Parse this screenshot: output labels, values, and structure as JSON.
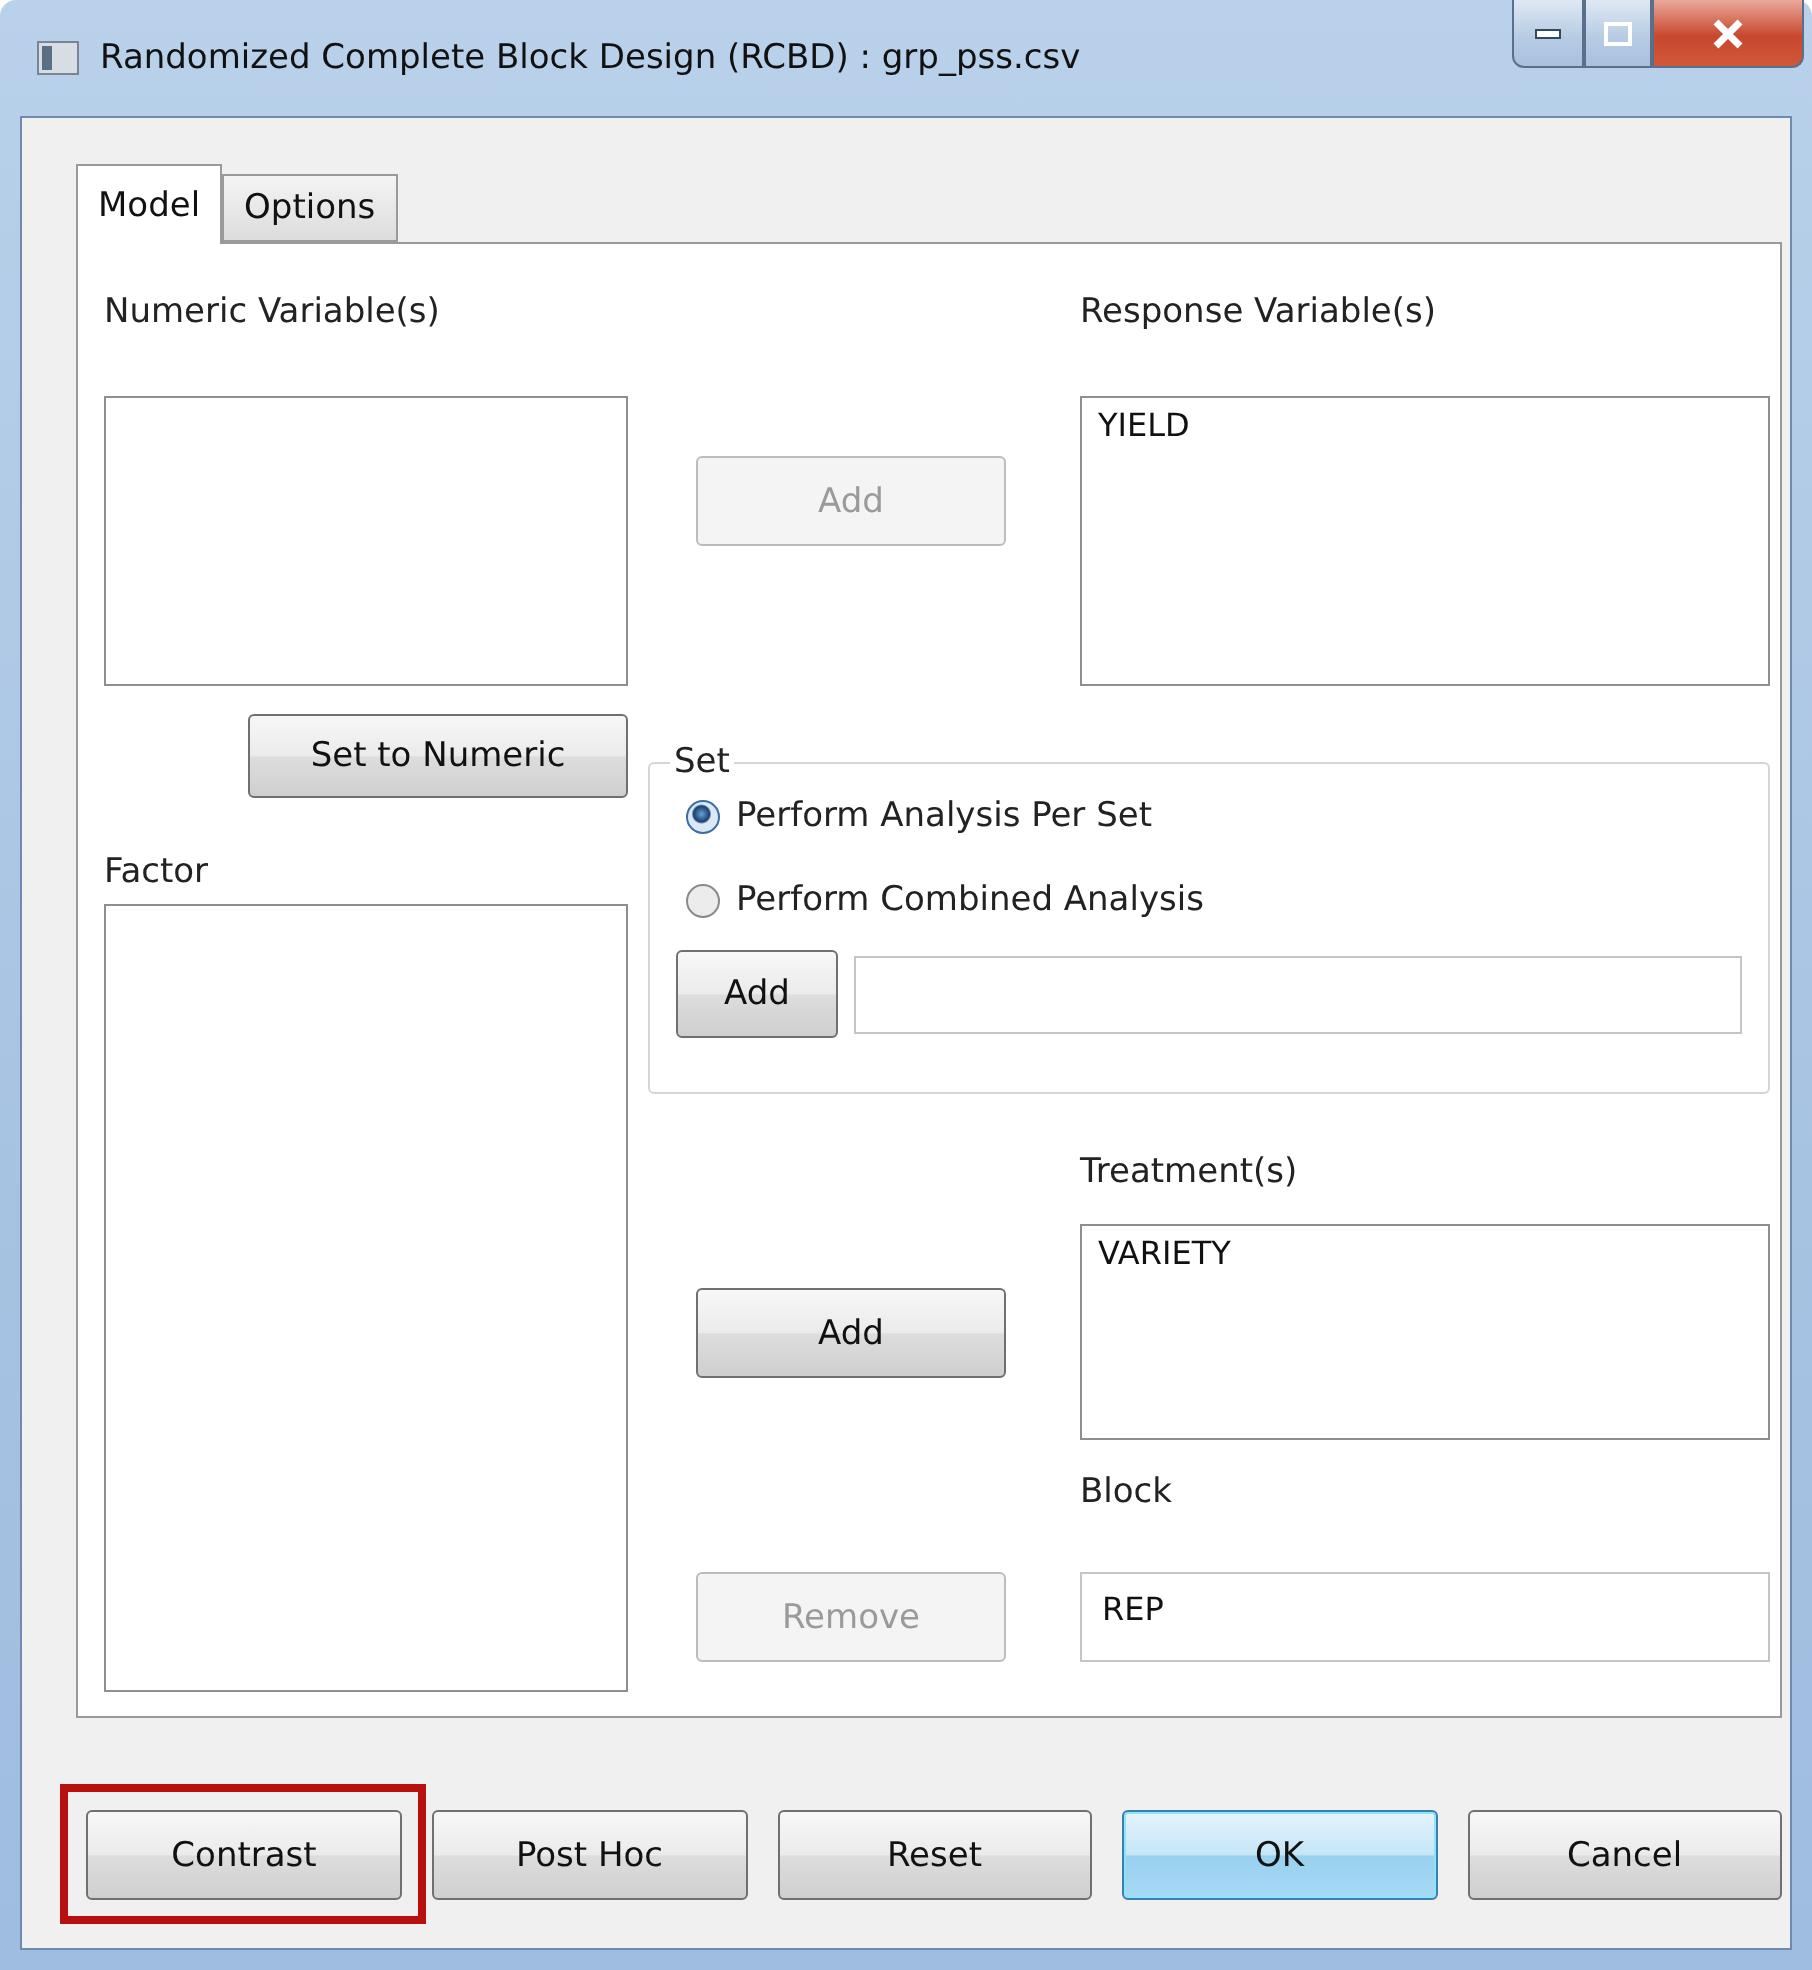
{
  "window": {
    "title": "Randomized Complete Block Design (RCBD) : grp_pss.csv"
  },
  "tabs": [
    {
      "label": "Model",
      "selected": true
    },
    {
      "label": "Options",
      "selected": false
    }
  ],
  "numeric": {
    "label": "Numeric Variable(s)"
  },
  "response": {
    "label": "Response Variable(s)",
    "items": [
      "YIELD"
    ]
  },
  "add_response": {
    "label": "Add",
    "disabled": true
  },
  "set_to_numeric": {
    "label": "Set to Numeric",
    "disabled": false
  },
  "factor": {
    "label": "Factor"
  },
  "set": {
    "legend": "Set",
    "options": [
      {
        "label": "Perform Analysis Per Set",
        "selected": true
      },
      {
        "label": "Perform Combined Analysis",
        "selected": false
      }
    ],
    "add": {
      "label": "Add",
      "disabled": false
    }
  },
  "treatment": {
    "label": "Treatment(s)",
    "items": [
      "VARIETY"
    ]
  },
  "add_treatment": {
    "label": "Add",
    "disabled": false
  },
  "block": {
    "label": "Block",
    "value": "REP"
  },
  "remove": {
    "label": "Remove",
    "disabled": true
  },
  "buttons": [
    {
      "label": "Contrast",
      "default": false,
      "highlighted": true
    },
    {
      "label": "Post Hoc",
      "default": false,
      "highlighted": false
    },
    {
      "label": "Reset",
      "default": false,
      "highlighted": false
    },
    {
      "label": "OK",
      "default": true,
      "highlighted": false
    },
    {
      "label": "Cancel",
      "default": false,
      "highlighted": false
    }
  ]
}
